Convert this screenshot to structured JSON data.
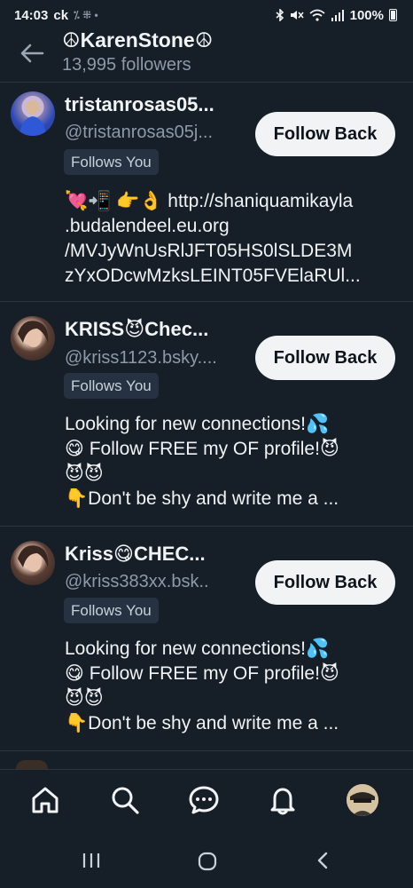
{
  "status": {
    "time": "14:03",
    "carrier": "ck",
    "extra_icons": "⁒ ⁜ •",
    "battery": "100%"
  },
  "header": {
    "title": "☮KarenStone☮",
    "followers": "13,995 followers"
  },
  "items": [
    {
      "name": "tristanrosas05...",
      "handle": "@tristanrosas05j...",
      "badge": "Follows You",
      "button": "Follow Back",
      "bio": [
        "💘📲 👉👌 http://shaniquamikayla",
        ".budalendeel.eu.org",
        "/MVJyWnUsRlJFT05HS0lSLDE3M",
        "zYxODcwMzksLEINT05FVElaRUl..."
      ]
    },
    {
      "name": "KRISS😈Chec...",
      "handle": "@kriss1123.bsky....",
      "badge": "Follows You",
      "button": "Follow Back",
      "bio": [
        "Looking for new connections!💦",
        "😋 Follow FREE my OF profile!😈",
        "😈😈",
        "👇Don't be shy and write me a ..."
      ]
    },
    {
      "name": "Kriss😋CHEC...",
      "handle": "@kriss383xx.bsk..",
      "badge": "Follows You",
      "button": "Follow Back",
      "bio": [
        "Looking for new connections!💦",
        "😋 Follow FREE my OF profile!😈",
        "😈😈",
        "👇Don't be shy and write me a ..."
      ]
    }
  ],
  "nav": {
    "icons": [
      "home-icon",
      "search-icon",
      "chat-icon",
      "bell-icon",
      "profile-avatar"
    ]
  },
  "colors": {
    "background": "#161e27",
    "button_bg": "#f1f3f5",
    "muted": "#8d9aa8",
    "badge_bg": "#263241"
  }
}
